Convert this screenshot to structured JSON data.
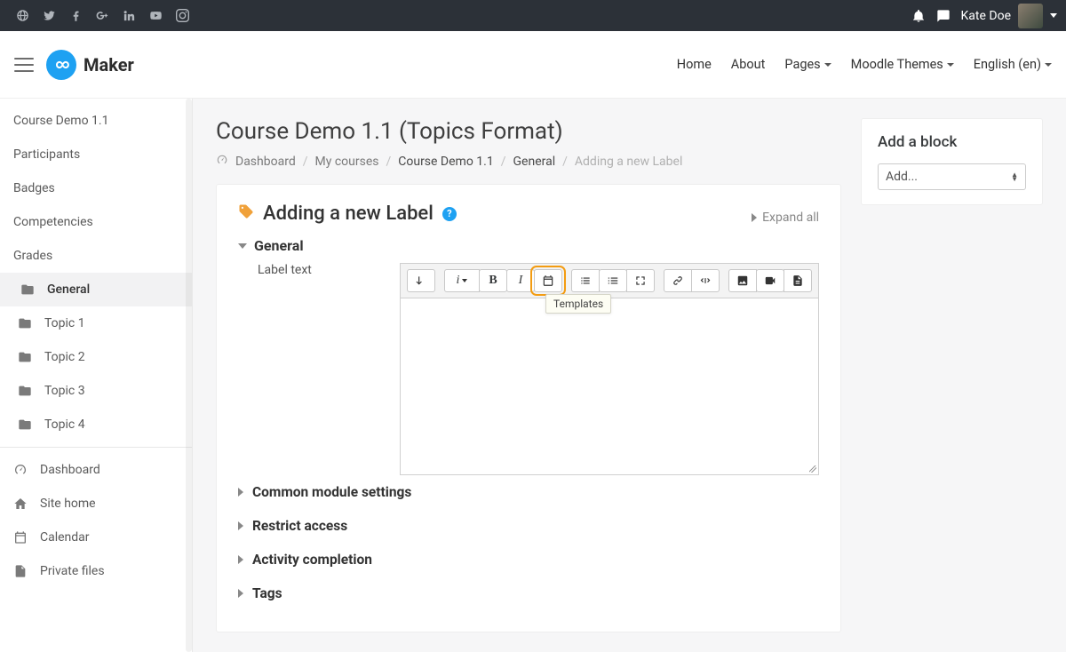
{
  "topbar": {
    "social": [
      "globe",
      "twitter",
      "facebook",
      "google-plus",
      "linkedin",
      "youtube",
      "instagram"
    ],
    "user_name": "Kate Doe"
  },
  "header": {
    "brand": "Maker",
    "nav": {
      "home": "Home",
      "about": "About",
      "pages": "Pages",
      "themes": "Moodle Themes",
      "lang": "English (en)"
    }
  },
  "sidebar": {
    "top": [
      {
        "label": "Course Demo 1.1"
      },
      {
        "label": "Participants"
      },
      {
        "label": "Badges"
      },
      {
        "label": "Competencies"
      },
      {
        "label": "Grades"
      }
    ],
    "course_sections": [
      {
        "label": "General",
        "active": true
      },
      {
        "label": "Topic 1"
      },
      {
        "label": "Topic 2"
      },
      {
        "label": "Topic 3"
      },
      {
        "label": "Topic 4"
      }
    ],
    "bottom": [
      {
        "label": "Dashboard",
        "icon": "gauge"
      },
      {
        "label": "Site home",
        "icon": "home"
      },
      {
        "label": "Calendar",
        "icon": "calendar"
      },
      {
        "label": "Private files",
        "icon": "file"
      }
    ]
  },
  "page": {
    "title": "Course Demo 1.1 (Topics Format)",
    "breadcrumb": {
      "dashboard": "Dashboard",
      "mycourses": "My courses",
      "course": "Course Demo 1.1",
      "section": "General",
      "current": "Adding a new Label"
    },
    "card_title": "Adding a new Label",
    "expand_all": "Expand all",
    "sections": {
      "general": "General",
      "label_text": "Label text",
      "common": "Common module settings",
      "restrict": "Restrict access",
      "activity": "Activity completion",
      "tags": "Tags"
    },
    "tooltip": "Templates"
  },
  "block": {
    "title": "Add a block",
    "select_placeholder": "Add..."
  }
}
